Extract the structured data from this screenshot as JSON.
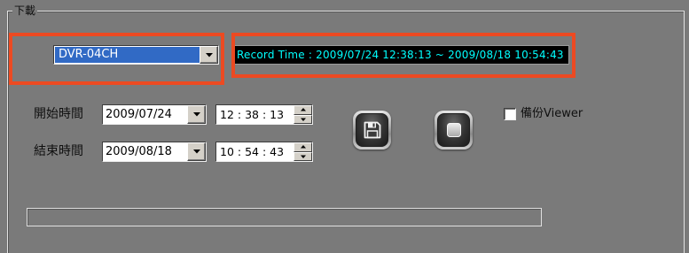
{
  "groupbox": {
    "title": "下載"
  },
  "channel": {
    "selected": "DVR-04CH"
  },
  "record_time": {
    "text": "Record Time : 2009/07/24 12:38:13 ~ 2009/08/18 10:54:43"
  },
  "start": {
    "label": "開始時間",
    "date": "2009/07/24",
    "time": "12 : 38 : 13"
  },
  "end": {
    "label": "結束時間",
    "date": "2009/08/18",
    "time": "10 : 54 : 43"
  },
  "actions": {
    "save_icon": "floppy-disk-icon",
    "stop_icon": "stop-icon"
  },
  "backup_viewer": {
    "label": "備份Viewer",
    "checked": false
  },
  "progress": {
    "fraction": 0
  },
  "colors": {
    "background": "#7a7a7a",
    "highlight": "#ec4a22",
    "selection": "#316ac5",
    "record_text": "#00ffff",
    "record_background": "#000000"
  }
}
